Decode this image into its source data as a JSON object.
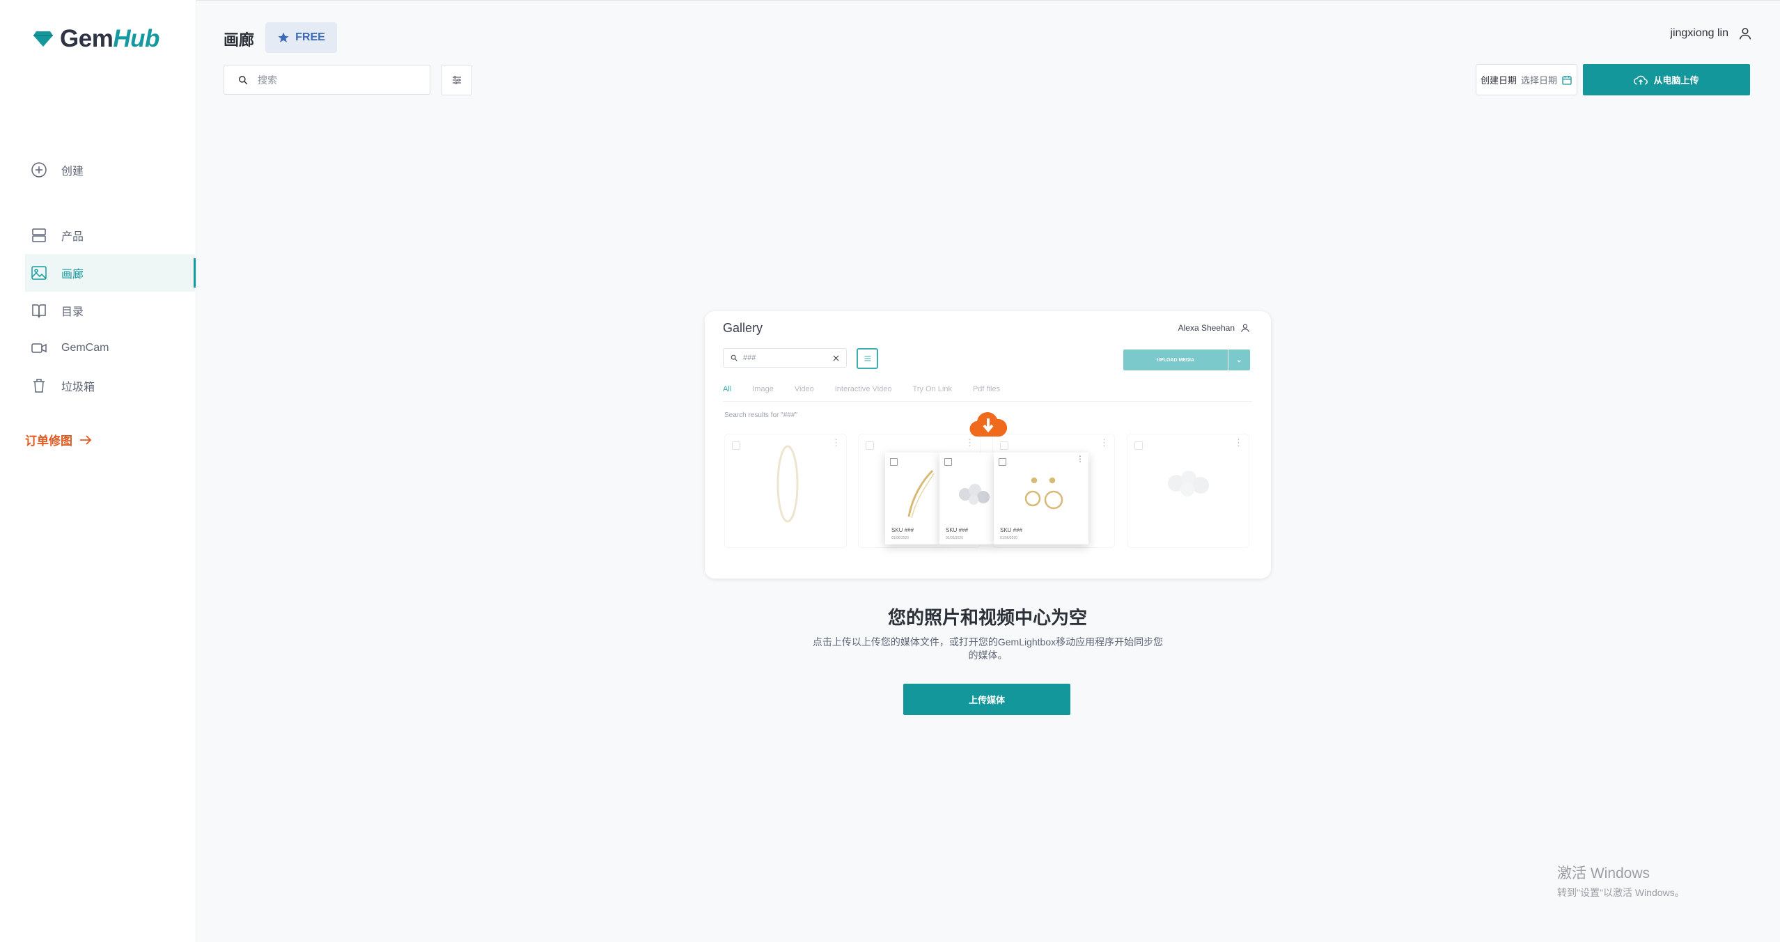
{
  "app": {
    "logo_gem": "Gem",
    "logo_hub": "Hub"
  },
  "sidebar": {
    "create": "创建",
    "items": [
      {
        "label": "产品",
        "icon": "layers-icon"
      },
      {
        "label": "画廊",
        "icon": "image-icon",
        "active": true
      },
      {
        "label": "目录",
        "icon": "book-icon"
      },
      {
        "label": "GemCam",
        "icon": "video-icon"
      },
      {
        "label": "垃圾箱",
        "icon": "trash-icon"
      }
    ],
    "order_link": "订单修图"
  },
  "header": {
    "title": "画廊",
    "plan_badge": "FREE",
    "user_name": "jingxiong lin"
  },
  "toolbar": {
    "search_placeholder": "搜索",
    "date_label": "创建日期",
    "date_placeholder": "选择日期",
    "upload_button": "从电脑上传"
  },
  "illustration": {
    "title": "Gallery",
    "user": "Alexa Sheehan",
    "search_value": "###",
    "upload_button": "UPLOAD MEDIA",
    "tabs": [
      "All",
      "Image",
      "Video",
      "Interactive Video",
      "Try On Link",
      "Pdf files"
    ],
    "results": "Search results for \"###\"",
    "card_sku": "SKU ###",
    "card_date": "01/06/2020"
  },
  "empty_state": {
    "title": "您的照片和视频中心为空",
    "description": "点击上传以上传您的媒体文件，或打开您的GemLightbox移动应用程序开始同步您的媒体。",
    "button": "上传媒体"
  },
  "watermark": {
    "line1": "激活 Windows",
    "line2": "转到\"设置\"以激活 Windows。"
  },
  "colors": {
    "accent": "#14979a",
    "order_link": "#e05a20",
    "badge_bg": "#e5ebf5",
    "badge_text": "#3c68b8"
  }
}
